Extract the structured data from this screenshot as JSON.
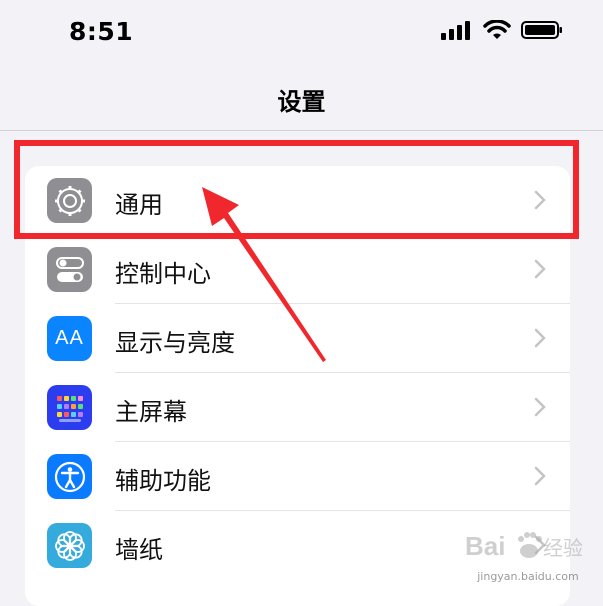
{
  "status_bar": {
    "time": "8:51",
    "icons": [
      "signal-icon",
      "wifi-icon",
      "battery-icon"
    ]
  },
  "nav": {
    "title": "设置"
  },
  "settings": {
    "items": [
      {
        "label": "通用",
        "icon": "gear-icon",
        "icon_bg": "#8e8e93"
      },
      {
        "label": "控制中心",
        "icon": "toggles-icon",
        "icon_bg": "#8e8e93"
      },
      {
        "label": "显示与亮度",
        "icon": "text-size-icon",
        "icon_bg": "#0a84ff",
        "icon_text": "AA"
      },
      {
        "label": "主屏幕",
        "icon": "home-screen-grid-icon",
        "icon_bg": "#2c3df0"
      },
      {
        "label": "辅助功能",
        "icon": "accessibility-icon",
        "icon_bg": "#0a7aff"
      },
      {
        "label": "墙纸",
        "icon": "flower-icon",
        "icon_bg": "#35aadc"
      }
    ]
  },
  "annotation": {
    "highlight_color": "#f0282d",
    "arrow_color": "#f0282d"
  },
  "watermark": {
    "brand": "Bai",
    "suffix": "经验",
    "site": "jingyan.baidu.com"
  }
}
